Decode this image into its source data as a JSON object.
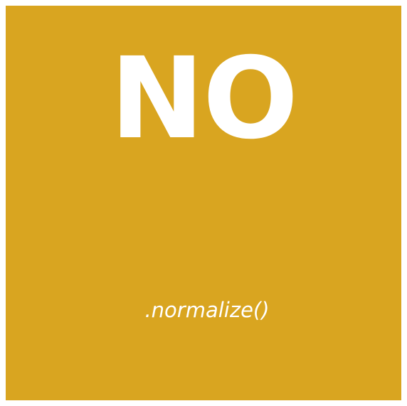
{
  "tile": {
    "background_color": "#D9A520",
    "text_color": "#FFFFFF",
    "headline": "NO",
    "caption": ".normalize()"
  }
}
